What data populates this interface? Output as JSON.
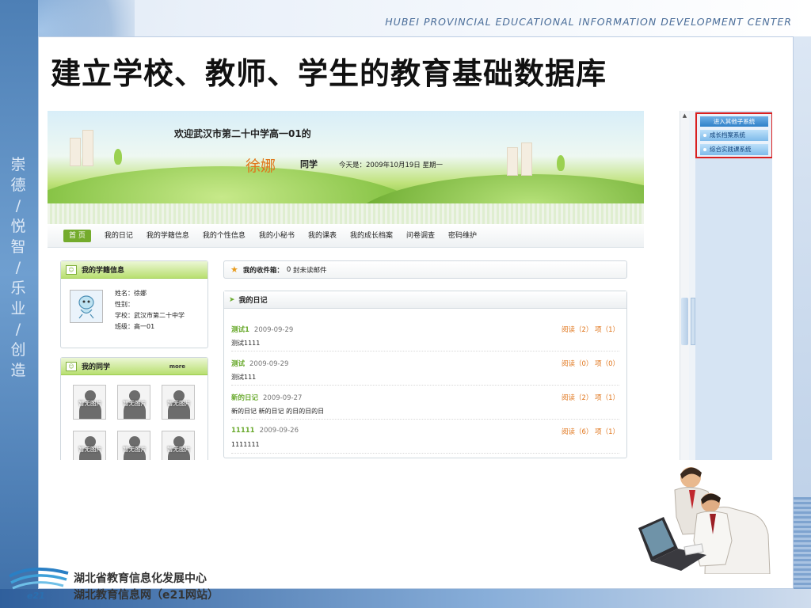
{
  "header": {
    "center_name": "HUBEI PROVINCIAL EDUCATIONAL INFORMATION DEVELOPMENT CENTER",
    "title": "建立学校、教师、学生的教育基础数据库"
  },
  "motto": [
    "崇",
    "德",
    "/",
    "悦",
    "智",
    "/",
    "乐",
    "业",
    "/",
    "创",
    "造"
  ],
  "app": {
    "welcome": "欢迎武汉市第二十中学高一01的",
    "user_name": "徐娜",
    "greeting": "同学",
    "today": "今天是：2009年10月19日 星期一",
    "nav": [
      "首 页",
      "我的日记",
      "我的学籍信息",
      "我的个性信息",
      "我的小秘书",
      "我的课表",
      "我的成长档案",
      "问卷调查",
      "密码维护"
    ],
    "profile": {
      "title": "我的学籍信息",
      "name_label": "姓名：徐娜",
      "gender_label": "性别：",
      "school_label": "学校：武汉市第二十中学",
      "class_label": "班级：高一01"
    },
    "classmates": {
      "title": "我的同学",
      "more": "more",
      "no_image": "暂无图片",
      "count_visible": 6
    },
    "inbox": {
      "label": "我的收件箱：",
      "count": "0",
      "unread": "封未读邮件"
    },
    "diary": {
      "title": "我的日记",
      "entries": [
        {
          "title": "测试1",
          "date": "2009-09-29",
          "body": "测试1111",
          "reads": "阅读（2）",
          "items": "项（1）"
        },
        {
          "title": "测试",
          "date": "2009-09-29",
          "body": "测试111",
          "reads": "阅读（0）",
          "items": "项（0）"
        },
        {
          "title": "新的日记",
          "date": "2009-09-27",
          "body": "新的日记  新的日记  的日的日的日",
          "reads": "阅读（2）",
          "items": "项（1）"
        },
        {
          "title": "11111",
          "date": "2009-09-26",
          "body": "1111111",
          "reads": "阅读（6）",
          "items": "项（1）"
        }
      ]
    },
    "systems": {
      "title": "进入其他子系统",
      "links": [
        "成长档案系统",
        "综合实践课系统"
      ]
    }
  },
  "footer": {
    "line1": "湖北省教育信息化发展中心",
    "line2": "湖北教育信息网（e21网站）",
    "logo_text": "e21"
  },
  "colors": {
    "accent_green": "#74ab2c",
    "accent_orange": "#e0751b",
    "highlight_red": "#d92020"
  }
}
